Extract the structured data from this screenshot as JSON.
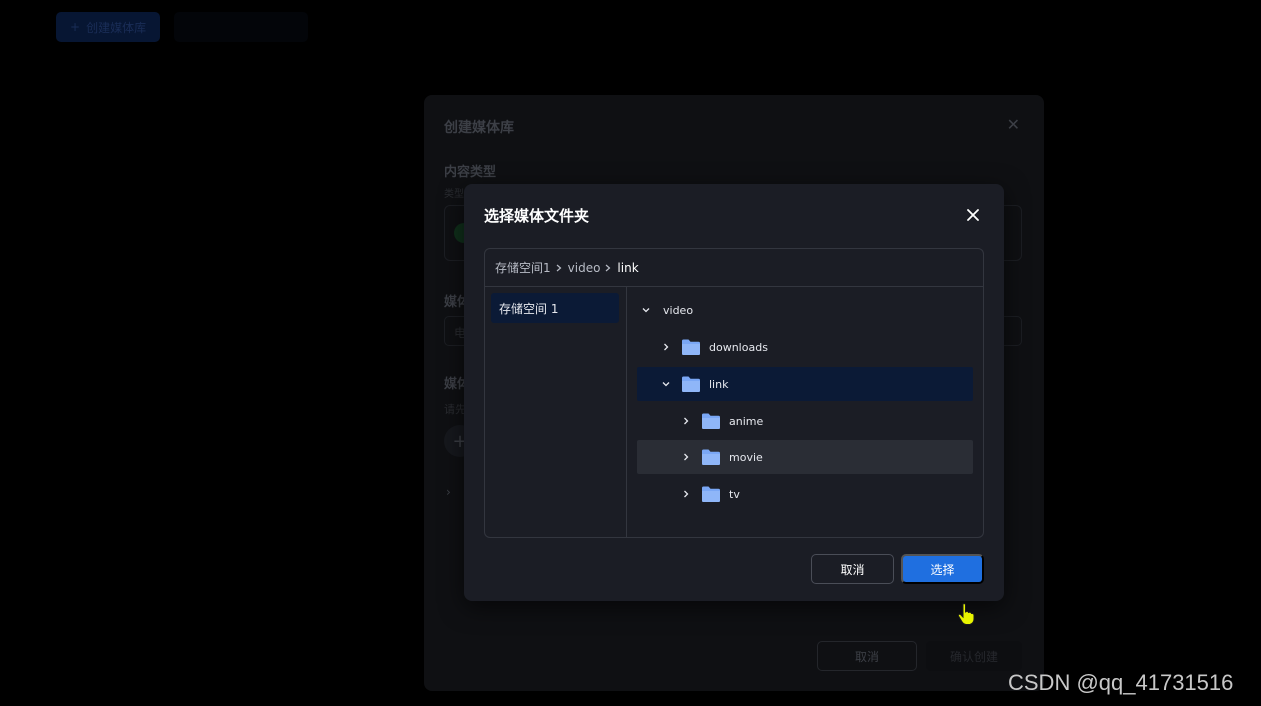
{
  "background": {
    "create_button_label": "创建媒体库",
    "plus_glyph": "+"
  },
  "underlying_dialog": {
    "title": "创建媒体库",
    "content_type_label": "内容类型",
    "content_type_hint": "类型",
    "media_type_label": "媒体",
    "media_type_value": "电",
    "media_folder_label": "媒体",
    "media_folder_hint": "请先",
    "cancel_label": "取消",
    "confirm_label": "确认创建"
  },
  "dialog": {
    "title": "选择媒体文件夹",
    "breadcrumb": [
      "存储空间1",
      "video",
      "link"
    ],
    "storages": [
      {
        "label": "存储空间 1",
        "selected": true
      }
    ],
    "tree": [
      {
        "label": "video",
        "depth": 0,
        "expanded": true,
        "folder_icon": false,
        "state": "normal"
      },
      {
        "label": "downloads",
        "depth": 1,
        "expanded": false,
        "folder_icon": true,
        "state": "normal"
      },
      {
        "label": "link",
        "depth": 1,
        "expanded": true,
        "folder_icon": true,
        "state": "selected"
      },
      {
        "label": "anime",
        "depth": 2,
        "expanded": false,
        "folder_icon": true,
        "state": "normal"
      },
      {
        "label": "movie",
        "depth": 2,
        "expanded": false,
        "folder_icon": true,
        "state": "hover"
      },
      {
        "label": "tv",
        "depth": 2,
        "expanded": false,
        "folder_icon": true,
        "state": "normal"
      }
    ],
    "cancel_label": "取消",
    "select_label": "选择"
  },
  "colors": {
    "accent": "#1f6fe0",
    "selected_row": "#0b1a36",
    "hover_row": "#2a2d35",
    "folder": "#7aa7f5",
    "dialog_bg": "#1b1d25"
  },
  "icons": {
    "close": "close-icon",
    "chevron_right": "chevron-right-icon",
    "chevron_down": "chevron-down-icon",
    "folder": "folder-icon",
    "cursor": "hand-pointer-icon"
  },
  "watermark": "CSDN @qq_41731516"
}
